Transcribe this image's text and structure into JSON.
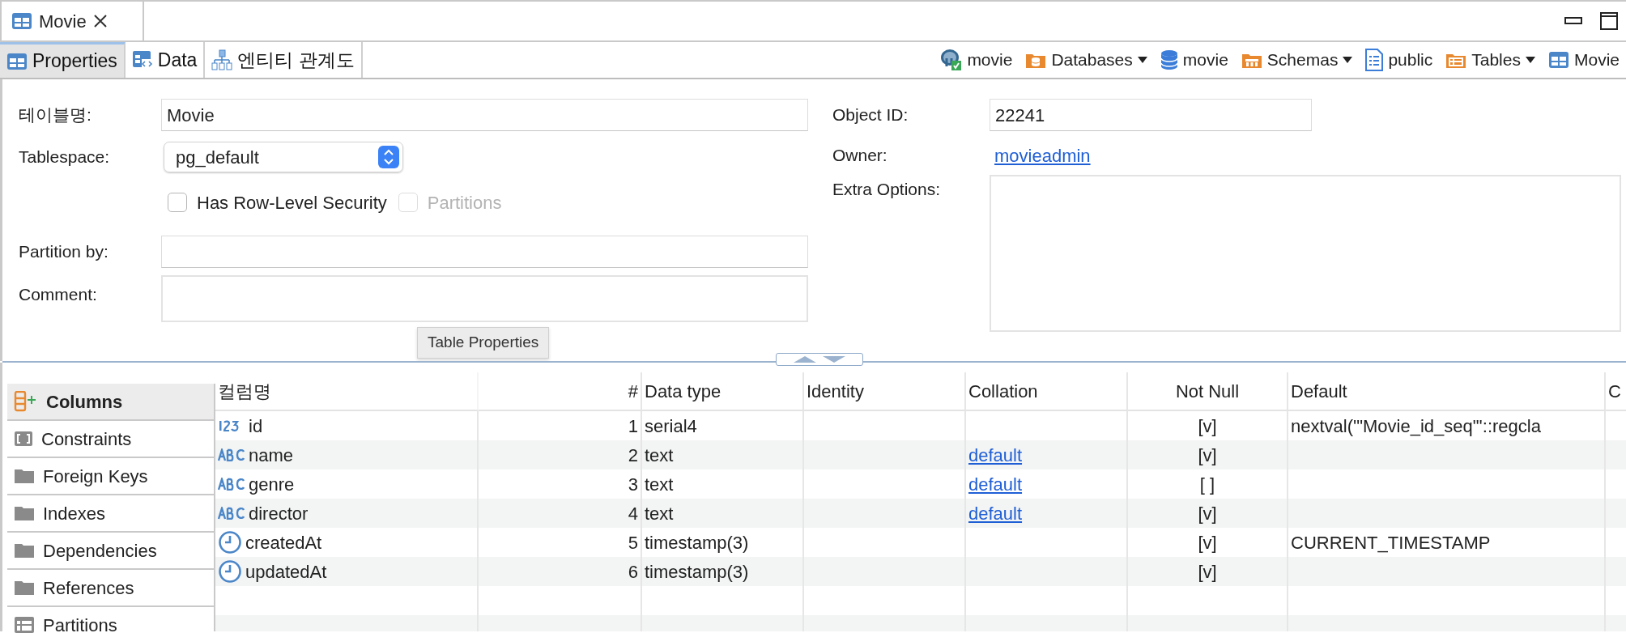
{
  "editor_tab": {
    "title": "Movie"
  },
  "subtabs": [
    {
      "label": "Properties",
      "kind": "table",
      "selected": true
    },
    {
      "label": "Data",
      "kind": "data",
      "selected": false
    },
    {
      "label": "엔티티 관계도",
      "kind": "diagram",
      "selected": false
    }
  ],
  "breadcrumb": [
    {
      "label": "movie",
      "kind": "server",
      "dropdown": false
    },
    {
      "label": "Databases",
      "kind": "databases",
      "dropdown": true
    },
    {
      "label": "movie",
      "kind": "database",
      "dropdown": false
    },
    {
      "label": "Schemas",
      "kind": "schemas",
      "dropdown": true
    },
    {
      "label": "public",
      "kind": "schema",
      "dropdown": false
    },
    {
      "label": "Tables",
      "kind": "tables",
      "dropdown": true
    },
    {
      "label": "Movie",
      "kind": "table",
      "dropdown": false
    }
  ],
  "form": {
    "table_name": {
      "label": "테이블명:",
      "value": "Movie"
    },
    "tablespace": {
      "label": "Tablespace:",
      "value": "pg_default"
    },
    "checkboxes": [
      {
        "label": "Has Row-Level Security",
        "checked": false,
        "disabled": false
      },
      {
        "label": "Partitions",
        "checked": false,
        "disabled": true
      }
    ],
    "partition_by": {
      "label": "Partition by:"
    },
    "comment": {
      "label": "Comment:"
    },
    "object_id": {
      "label": "Object ID:",
      "value": "22241"
    },
    "owner": {
      "label": "Owner:",
      "value": "movieadmin"
    },
    "extra_options": {
      "label": "Extra Options:"
    }
  },
  "tooltip": "Table Properties",
  "sidebar": {
    "items": [
      {
        "label": "Columns",
        "kind": "columns",
        "selected": true
      },
      {
        "label": "Constraints",
        "kind": "constraints",
        "selected": false
      },
      {
        "label": "Foreign Keys",
        "kind": "folder",
        "selected": false
      },
      {
        "label": "Indexes",
        "kind": "folder",
        "selected": false
      },
      {
        "label": "Dependencies",
        "kind": "folder",
        "selected": false
      },
      {
        "label": "References",
        "kind": "folder",
        "selected": false
      },
      {
        "label": "Partitions",
        "kind": "partitions",
        "selected": false
      }
    ]
  },
  "table": {
    "columns": [
      "컬럼명",
      "#",
      "Data type",
      "Identity",
      "Collation",
      "Not Null",
      "Default",
      "C"
    ],
    "rows": [
      {
        "kind": "number",
        "name": "id",
        "num": "1",
        "type": "serial4",
        "not_null": "[v]",
        "default": "nextval('\"Movie_id_seq\"'::regcla"
      },
      {
        "kind": "text",
        "name": "name",
        "num": "2",
        "type": "text",
        "collation": "default",
        "not_null": "[v]"
      },
      {
        "kind": "text",
        "name": "genre",
        "num": "3",
        "type": "text",
        "collation": "default",
        "not_null": "[ ]"
      },
      {
        "kind": "text",
        "name": "director",
        "num": "4",
        "type": "text",
        "collation": "default",
        "not_null": "[v]"
      },
      {
        "kind": "time",
        "name": "createdAt",
        "num": "5",
        "type": "timestamp(3)",
        "not_null": "[v]",
        "default": "CURRENT_TIMESTAMP"
      },
      {
        "kind": "time",
        "name": "updatedAt",
        "num": "6",
        "type": "timestamp(3)",
        "not_null": "[v]"
      }
    ]
  }
}
